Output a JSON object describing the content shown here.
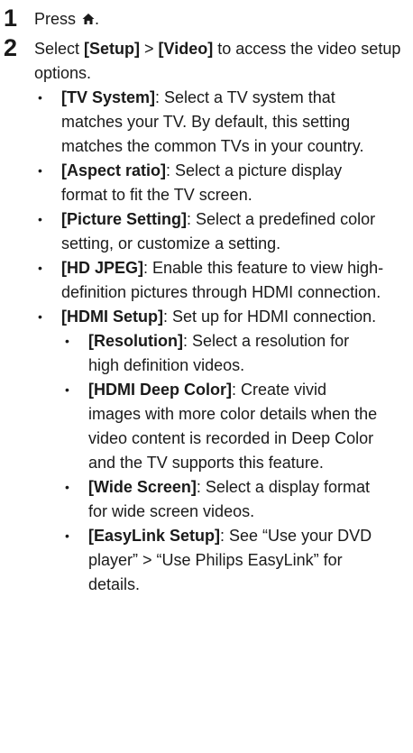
{
  "steps": {
    "step1": {
      "number": "1",
      "text": "Press",
      "icon": "home-icon",
      "suffix": "."
    },
    "step2": {
      "number": "2",
      "prefix": "Select ",
      "setup": "[Setup]",
      "sep": " > ",
      "video": "[Video]",
      "suffix": " to access the video setup options."
    }
  },
  "options": [
    {
      "label": "[TV System]",
      "desc": ": Select a TV system that matches your TV. By default, this setting matches the common TVs in your country."
    },
    {
      "label": "[Aspect ratio]",
      "desc": ": Select a picture display format to fit the TV screen."
    },
    {
      "label": "[Picture Setting]",
      "desc": ": Select a predefined color setting, or customize a setting."
    },
    {
      "label": "[HD JPEG]",
      "desc": ": Enable this feature to view high-definition pictures through HDMI connection."
    },
    {
      "label": "[HDMI Setup]",
      "desc": ": Set up for HDMI connection."
    }
  ],
  "hdmi_options": [
    {
      "label": "[Resolution]",
      "desc": ": Select a resolution for high definition videos."
    },
    {
      "label": "[HDMI Deep Color]",
      "desc": ": Create vivid images with more color details when the video content is recorded in Deep Color and the TV supports this feature."
    },
    {
      "label": "[Wide Screen]",
      "desc": ": Select a display format for wide screen videos."
    },
    {
      "label": "[EasyLink Setup]",
      "desc": ": See “Use your DVD player” > “Use Philips EasyLink” for details."
    }
  ]
}
